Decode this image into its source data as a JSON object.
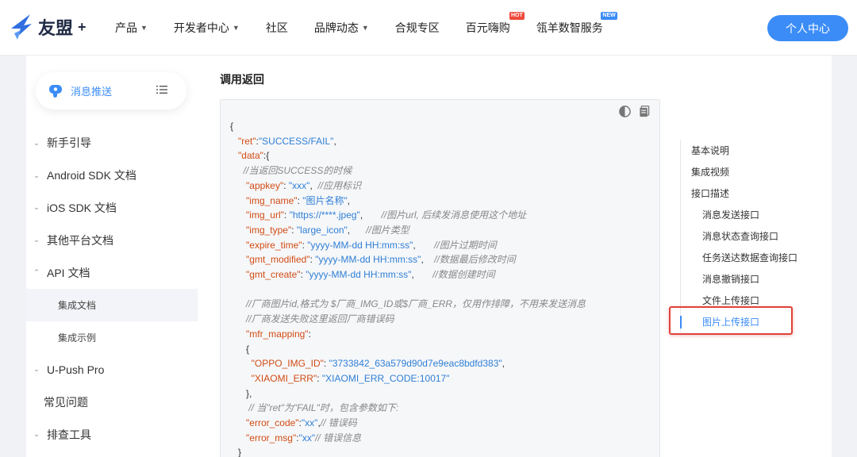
{
  "header": {
    "logo_text": "友盟",
    "logo_plus": "+",
    "nav": [
      {
        "label": "产品",
        "caret": true
      },
      {
        "label": "开发者中心",
        "caret": true
      },
      {
        "label": "社区",
        "caret": false
      },
      {
        "label": "品牌动态",
        "caret": true
      },
      {
        "label": "合规专区",
        "caret": false
      },
      {
        "label": "百元嗨购",
        "badge": "HOT"
      },
      {
        "label": "瓴羊数智服务",
        "badge": "NEW"
      }
    ],
    "personal_center": "个人中心"
  },
  "sidebar": {
    "app_label": "消息推送",
    "items": [
      {
        "label": "新手引导",
        "type": "collapsed"
      },
      {
        "label": "Android SDK 文档",
        "type": "collapsed"
      },
      {
        "label": "iOS SDK 文档",
        "type": "collapsed"
      },
      {
        "label": "其他平台文档",
        "type": "collapsed"
      },
      {
        "label": "API 文档",
        "type": "expanded"
      },
      {
        "label": "集成文档",
        "type": "sub-active"
      },
      {
        "label": "集成示例",
        "type": "sub"
      },
      {
        "label": "U-Push Pro",
        "type": "collapsed"
      },
      {
        "label": "常见问题",
        "type": "plain"
      },
      {
        "label": "排查工具",
        "type": "collapsed"
      }
    ]
  },
  "main": {
    "section_title": "调用返回",
    "code": {
      "open_brace": "{",
      "ret_key": "\"ret\"",
      "ret_val": "\"SUCCESS/FAIL\"",
      "data_key": "\"data\"",
      "comment_success": "//当返回SUCCESS的时候",
      "appkey_key": "\"appkey\"",
      "appkey_val": "\"xxx\"",
      "appkey_comment": "//应用标识",
      "img_name_key": "\"img_name\"",
      "img_name_val": "\"图片名称\"",
      "img_url_key": "\"img_url\"",
      "img_url_val": "\"https://****.jpeg\"",
      "img_url_comment": "//图片url, 后续发消息使用这个地址",
      "img_type_key": "\"img_type\"",
      "img_type_val": "\"large_icon\"",
      "img_type_comment": "//图片类型",
      "expire_key": "\"expire_time\"",
      "expire_val": "\"yyyy-MM-dd HH:mm:ss\"",
      "expire_comment": "//图片过期时间",
      "gmt_mod_key": "\"gmt_modified\"",
      "gmt_mod_val": "\"yyyy-MM-dd HH:mm:ss\"",
      "gmt_mod_comment": "//数据最后修改时间",
      "gmt_create_key": "\"gmt_create\"",
      "gmt_create_val": "\"yyyy-MM-dd HH:mm:ss\"",
      "gmt_create_comment": "//数据创建时间",
      "vendor_comment1": "//厂商图片id,格式为 $厂商_IMG_ID或$厂商_ERR，仅用作排障，不用来发送消息",
      "vendor_comment2": "//厂商发送失败这里返回厂商错误码",
      "mfr_key": "\"mfr_mapping\"",
      "oppo_key": "\"OPPO_IMG_ID\"",
      "oppo_val": "\"3733842_63a579d90d7e9eac8bdfd383\"",
      "xiaomi_key": "\"XIAOMI_ERR\"",
      "xiaomi_val": "\"XIAOMI_ERR_CODE:10017\"",
      "fail_comment": "// 当\"ret\"为\"FAIL\"时，包含参数如下:",
      "error_code_key": "\"error_code\"",
      "error_code_val": "\"xx\"",
      "error_code_comment": "// 错误码",
      "error_msg_key": "\"error_msg\"",
      "error_msg_val": "\"xx\"",
      "error_msg_comment": "// 错误信息"
    }
  },
  "toc": {
    "items": [
      {
        "label": "基本说明",
        "level": 1
      },
      {
        "label": "集成视频",
        "level": 1
      },
      {
        "label": "接口描述",
        "level": 1
      },
      {
        "label": "消息发送接口",
        "level": 2
      },
      {
        "label": "消息状态查询接口",
        "level": 2
      },
      {
        "label": "任务送达数据查询接口",
        "level": 2
      },
      {
        "label": "消息撤销接口",
        "level": 2
      },
      {
        "label": "文件上传接口",
        "level": 2
      },
      {
        "label": "图片上传接口",
        "level": 2,
        "active": true
      }
    ]
  },
  "colors": {
    "accent": "#3b8cf7",
    "highlight_border": "#e0423a"
  }
}
